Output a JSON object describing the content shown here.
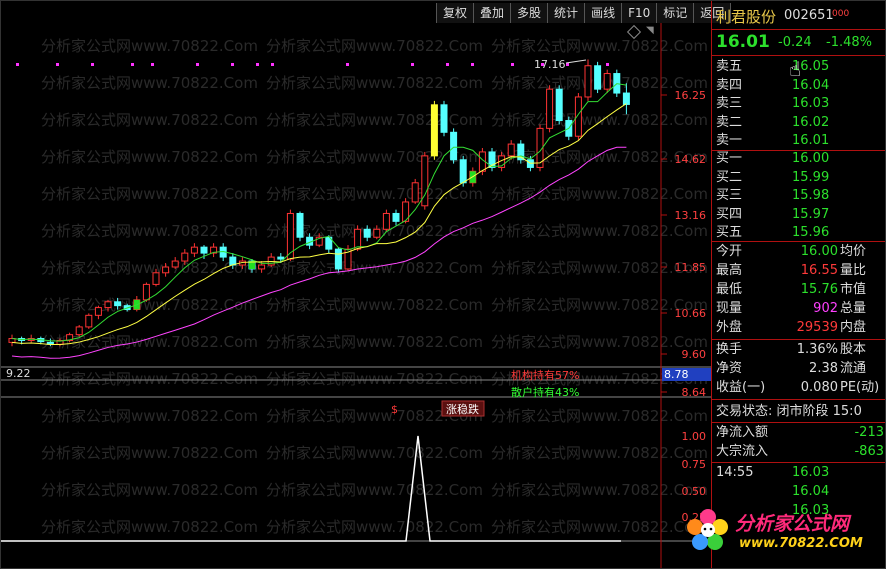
{
  "toolbar": [
    "复权",
    "叠加",
    "多股",
    "统计",
    "画线",
    "F10",
    "标记",
    "返回"
  ],
  "watermark": "分析家公式网www.70822.Com",
  "chart_data": {
    "type": "candlestick",
    "price_axis": [
      "16.25",
      "14.62",
      "13.16",
      "11.85",
      "10.66",
      "9.60",
      "8.64"
    ],
    "indicator_axis": [
      "1.00",
      "0.75",
      "0.50",
      "0.25"
    ],
    "high_label": "17.16",
    "low_label": "9.22",
    "last_value_label": "8.78",
    "annotation_institution": "机构持有57%",
    "annotation_retail": "散户持有43%",
    "badge_label": "涨稳跌",
    "dollar_sign": "$",
    "colors": {
      "up": "#ff3333",
      "down": "#55ffff",
      "ma1": "#ffffff",
      "ma2": "#ffff44",
      "ma3": "#ff44ff",
      "signal": "#ffffff"
    }
  },
  "panel": {
    "name": "利君股份",
    "code": "002651",
    "flag": "000",
    "price": "16.01",
    "change": "-0.24",
    "change_pct": "-1.48%",
    "asks": [
      {
        "label": "卖五",
        "price": "16.05"
      },
      {
        "label": "卖四",
        "price": "16.04"
      },
      {
        "label": "卖三",
        "price": "16.03"
      },
      {
        "label": "卖二",
        "price": "16.02"
      },
      {
        "label": "卖一",
        "price": "16.01"
      }
    ],
    "bids": [
      {
        "label": "买一",
        "price": "16.00"
      },
      {
        "label": "买二",
        "price": "15.99"
      },
      {
        "label": "买三",
        "price": "15.98"
      },
      {
        "label": "买四",
        "price": "15.97"
      },
      {
        "label": "买五",
        "price": "15.96"
      }
    ],
    "stats": [
      {
        "l": "今开",
        "v": "16.00",
        "c": "g",
        "r": "均价"
      },
      {
        "l": "最高",
        "v": "16.55",
        "c": "r",
        "r": "量比"
      },
      {
        "l": "最低",
        "v": "15.76",
        "c": "g",
        "r": "市值"
      },
      {
        "l": "现量",
        "v": "902",
        "c": "m",
        "r": "总量"
      },
      {
        "l": "外盘",
        "v": "29539",
        "c": "r",
        "r": "内盘"
      }
    ],
    "stats2": [
      {
        "l": "换手",
        "v": "1.36%",
        "c": "w",
        "r": "股本"
      },
      {
        "l": "净资",
        "v": "2.38",
        "c": "w",
        "r": "流通"
      },
      {
        "l": "收益(一)",
        "v": "0.080",
        "c": "w",
        "r": "PE(动)"
      }
    ],
    "trade_state": "交易状态: 闭市阶段 15:0",
    "flow_net_label": "净流入额",
    "flow_net_value": "-213",
    "flow_block_label": "大宗流入",
    "flow_block_value": "-863",
    "ticks": [
      {
        "t": "14:55",
        "p": "16.03"
      },
      {
        "t": "",
        "p": "16.04"
      },
      {
        "t": "",
        "p": "16.03"
      }
    ]
  },
  "logo": {
    "title": "分析家公式网",
    "url": "www.70822.COM"
  }
}
